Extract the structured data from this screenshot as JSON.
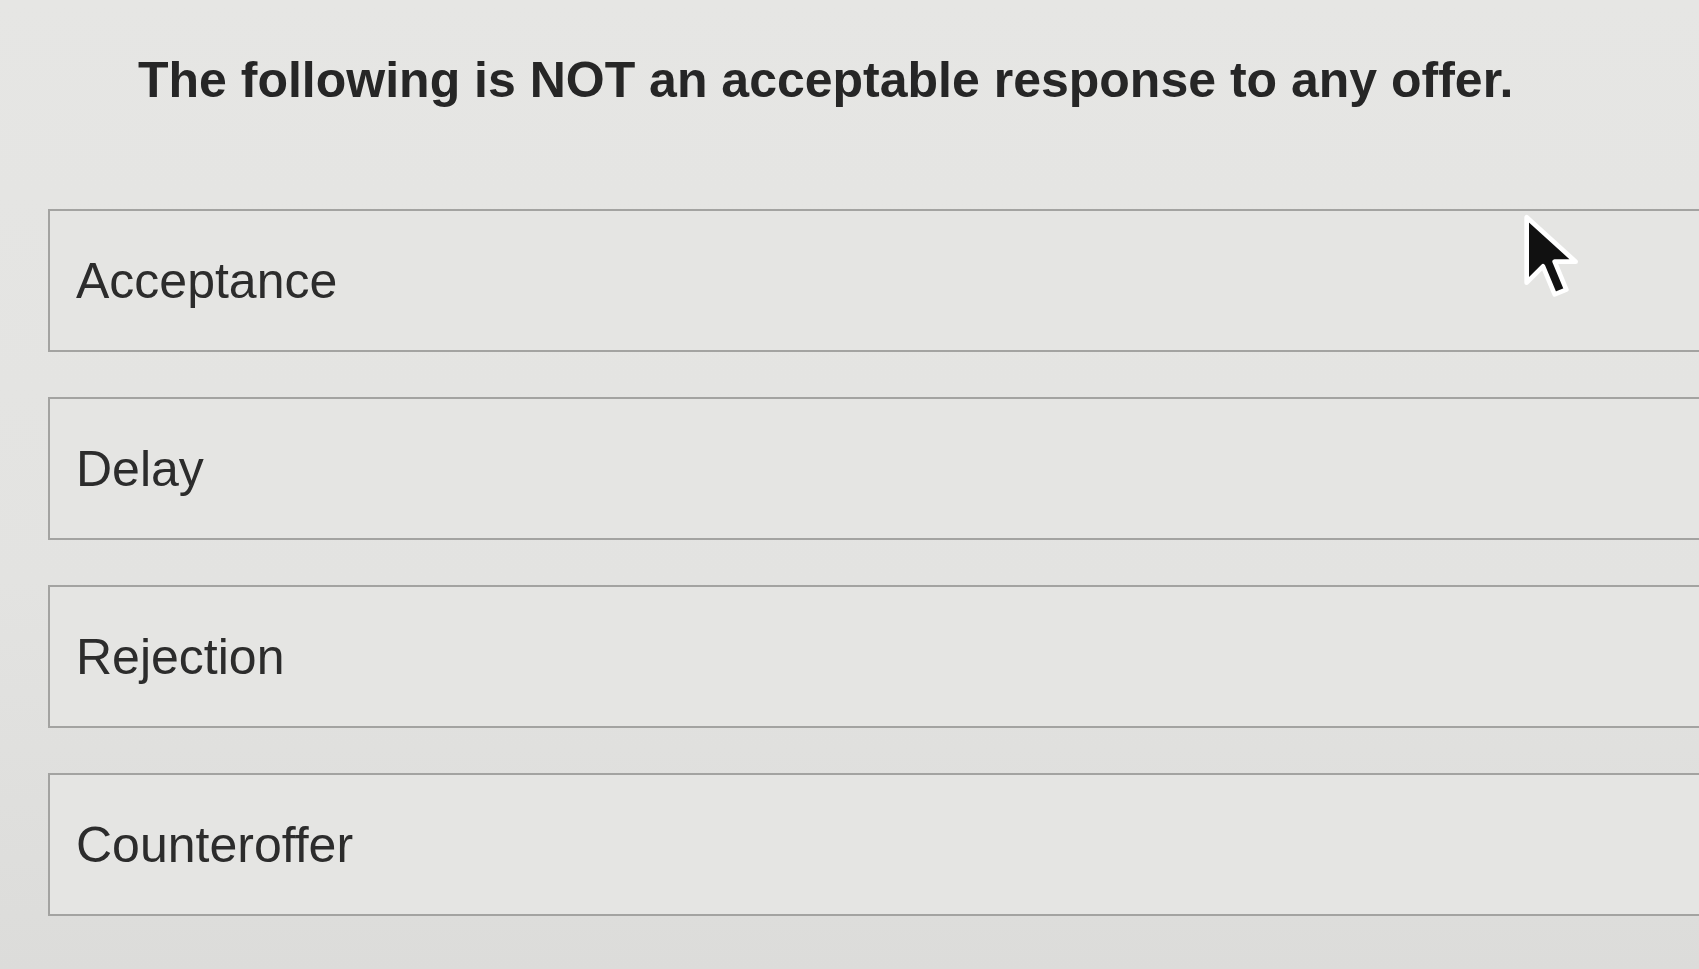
{
  "question": {
    "text": "The following is NOT an acceptable response to any offer."
  },
  "options": [
    {
      "label": "Acceptance"
    },
    {
      "label": "Delay"
    },
    {
      "label": "Rejection"
    },
    {
      "label": "Counteroffer"
    }
  ]
}
